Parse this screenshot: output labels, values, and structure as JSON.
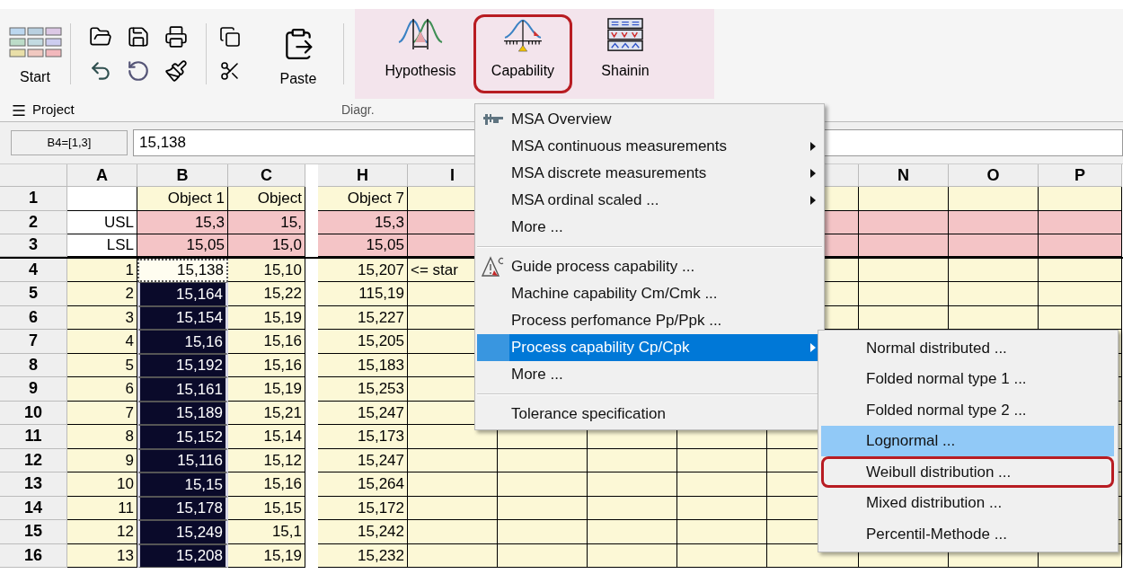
{
  "ribbon": {
    "start": {
      "label": "Start"
    },
    "clipboard": {
      "label": "Paste"
    },
    "analysis": [
      {
        "kind": "hypothesis",
        "label": "Hypothesis",
        "highlighted": false
      },
      {
        "kind": "capability",
        "label": "Capability",
        "highlighted": true
      },
      {
        "kind": "shainin",
        "label": "Shainin",
        "highlighted": false
      }
    ],
    "group_labels": [
      "Project",
      "Diagr."
    ]
  },
  "formula_bar": {
    "cell_ref": "B4=[1,3]",
    "value": "15,138"
  },
  "sheet": {
    "columns": [
      {
        "label": "A"
      },
      {
        "label": "B"
      },
      {
        "label": "C"
      },
      {
        "label": "H"
      },
      {
        "label": "I"
      },
      {},
      {},
      {},
      {},
      {
        "label": "N"
      },
      {
        "label": "O"
      },
      {
        "label": "P"
      }
    ],
    "rows": [
      {
        "number": "1",
        "kind": "header",
        "cells": [
          {
            "selected": false,
            "active": false
          },
          {
            "text": "Object 1",
            "selected": false,
            "active": false
          },
          {
            "text": "Object",
            "selected": false,
            "active": false
          },
          {
            "text": "Object 7",
            "selected": false,
            "active": false
          }
        ]
      },
      {
        "number": "2",
        "kind": "limit",
        "cells": [
          {
            "text": "USL",
            "selected": false,
            "active": false
          },
          {
            "text": "15,3",
            "selected": false,
            "active": false
          },
          {
            "text": "15,",
            "selected": false,
            "active": false
          },
          {
            "text": "15,3",
            "selected": false,
            "active": false
          }
        ]
      },
      {
        "number": "3",
        "kind": "limit",
        "cells": [
          {
            "text": "LSL",
            "selected": false,
            "active": false
          },
          {
            "text": "15,05",
            "selected": false,
            "active": false
          },
          {
            "text": "15,0",
            "selected": false,
            "active": false
          },
          {
            "text": "15,05",
            "selected": false,
            "active": false
          }
        ]
      },
      {
        "number": "4",
        "kind": "data",
        "cells": [
          {
            "text": "1",
            "selected": false,
            "active": false
          },
          {
            "text": "15,138",
            "selected": false,
            "active": true
          },
          {
            "text": "15,10",
            "selected": false,
            "active": false
          },
          {
            "text": "15,207",
            "selected": false,
            "active": false
          },
          {
            "text": "<= star",
            "selected": false,
            "active": false
          }
        ]
      },
      {
        "number": "5",
        "kind": "data",
        "cells": [
          {
            "text": "2",
            "selected": false,
            "active": false
          },
          {
            "text": "15,164",
            "selected": true,
            "active": false
          },
          {
            "text": "15,22",
            "selected": false,
            "active": false
          },
          {
            "text": "115,19",
            "selected": false,
            "active": false
          }
        ]
      },
      {
        "number": "6",
        "kind": "data",
        "cells": [
          {
            "text": "3",
            "selected": false,
            "active": false
          },
          {
            "text": "15,154",
            "selected": true,
            "active": false
          },
          {
            "text": "15,19",
            "selected": false,
            "active": false
          },
          {
            "text": "15,227",
            "selected": false,
            "active": false
          }
        ]
      },
      {
        "number": "7",
        "kind": "data",
        "cells": [
          {
            "text": "4",
            "selected": false,
            "active": false
          },
          {
            "text": "15,16",
            "selected": true,
            "active": false
          },
          {
            "text": "15,16",
            "selected": false,
            "active": false
          },
          {
            "text": "15,205",
            "selected": false,
            "active": false
          }
        ]
      },
      {
        "number": "8",
        "kind": "data",
        "cells": [
          {
            "text": "5",
            "selected": false,
            "active": false
          },
          {
            "text": "15,192",
            "selected": true,
            "active": false
          },
          {
            "text": "15,16",
            "selected": false,
            "active": false
          },
          {
            "text": "15,183",
            "selected": false,
            "active": false
          }
        ]
      },
      {
        "number": "9",
        "kind": "data",
        "cells": [
          {
            "text": "6",
            "selected": false,
            "active": false
          },
          {
            "text": "15,161",
            "selected": true,
            "active": false
          },
          {
            "text": "15,19",
            "selected": false,
            "active": false
          },
          {
            "text": "15,253",
            "selected": false,
            "active": false
          }
        ]
      },
      {
        "number": "10",
        "kind": "data",
        "cells": [
          {
            "text": "7",
            "selected": false,
            "active": false
          },
          {
            "text": "15,189",
            "selected": true,
            "active": false
          },
          {
            "text": "15,21",
            "selected": false,
            "active": false
          },
          {
            "text": "15,247",
            "selected": false,
            "active": false
          }
        ]
      },
      {
        "number": "11",
        "kind": "data",
        "cells": [
          {
            "text": "8",
            "selected": false,
            "active": false
          },
          {
            "text": "15,152",
            "selected": true,
            "active": false
          },
          {
            "text": "15,14",
            "selected": false,
            "active": false
          },
          {
            "text": "15,173",
            "selected": false,
            "active": false
          }
        ]
      },
      {
        "number": "12",
        "kind": "data",
        "cells": [
          {
            "text": "9",
            "selected": false,
            "active": false
          },
          {
            "text": "15,116",
            "selected": true,
            "active": false
          },
          {
            "text": "15,12",
            "selected": false,
            "active": false
          },
          {
            "text": "15,247",
            "selected": false,
            "active": false
          }
        ]
      },
      {
        "number": "13",
        "kind": "data",
        "cells": [
          {
            "text": "10",
            "selected": false,
            "active": false
          },
          {
            "text": "15,15",
            "selected": true,
            "active": false
          },
          {
            "text": "15,16",
            "selected": false,
            "active": false
          },
          {
            "text": "15,264",
            "selected": false,
            "active": false
          }
        ]
      },
      {
        "number": "14",
        "kind": "data",
        "cells": [
          {
            "text": "11",
            "selected": false,
            "active": false
          },
          {
            "text": "15,178",
            "selected": true,
            "active": false
          },
          {
            "text": "15,15",
            "selected": false,
            "active": false
          },
          {
            "text": "15,172",
            "selected": false,
            "active": false
          }
        ]
      },
      {
        "number": "15",
        "kind": "data",
        "cells": [
          {
            "text": "12",
            "selected": false,
            "active": false
          },
          {
            "text": "15,249",
            "selected": true,
            "active": false
          },
          {
            "text": "15,1",
            "selected": false,
            "active": false
          },
          {
            "text": "15,242",
            "selected": false,
            "active": false
          }
        ]
      },
      {
        "number": "16",
        "kind": "data",
        "cells": [
          {
            "text": "13",
            "selected": false,
            "active": false
          },
          {
            "text": "15,208",
            "selected": true,
            "active": false
          },
          {
            "text": "15,19",
            "selected": false,
            "active": false
          },
          {
            "text": "15,232",
            "selected": false,
            "active": false
          }
        ]
      }
    ]
  },
  "menu": {
    "items": [
      {
        "kind": "measure",
        "label": "MSA Overview",
        "submenu": false,
        "selected": false
      },
      {
        "kind": "item",
        "label": "MSA continuous measurements",
        "submenu": true,
        "selected": false
      },
      {
        "kind": "item",
        "label": "MSA discrete measurements",
        "submenu": true,
        "selected": false
      },
      {
        "kind": "item",
        "label": "MSA ordinal scaled ...",
        "submenu": true,
        "selected": false
      },
      {
        "kind": "item",
        "label": "More ...",
        "submenu": false,
        "selected": false
      },
      {
        "kind": "separator"
      },
      {
        "kind": "guide",
        "label": "Guide process capability ...",
        "submenu": false,
        "selected": false
      },
      {
        "kind": "item",
        "label": "Machine capability Cm/Cmk ...",
        "submenu": false,
        "selected": false
      },
      {
        "kind": "item",
        "label": "Process perfomance Pp/Ppk ...",
        "submenu": false,
        "selected": false
      },
      {
        "kind": "item",
        "label": "Process capability Cp/Cpk",
        "submenu": true,
        "selected": true
      },
      {
        "kind": "item",
        "label": "More ...",
        "submenu": false,
        "selected": false
      },
      {
        "kind": "separator"
      },
      {
        "kind": "item",
        "label": "Tolerance specification",
        "submenu": false,
        "selected": false
      }
    ]
  },
  "submenu": {
    "items": [
      {
        "label": "Normal distributed ...",
        "selected": false,
        "highlighted": false
      },
      {
        "label": "Folded normal type 1 ...",
        "selected": false,
        "highlighted": false
      },
      {
        "label": "Folded normal type 2 ...",
        "selected": false,
        "highlighted": false
      },
      {
        "label": "Lognormal ...",
        "selected": true,
        "highlighted": false
      },
      {
        "label": "Weibull distribution ...",
        "selected": false,
        "highlighted": true
      },
      {
        "label": "Mixed distribution ...",
        "selected": false,
        "highlighted": false
      },
      {
        "label": "Percentil-Methode ...",
        "selected": false,
        "highlighted": false
      }
    ]
  }
}
